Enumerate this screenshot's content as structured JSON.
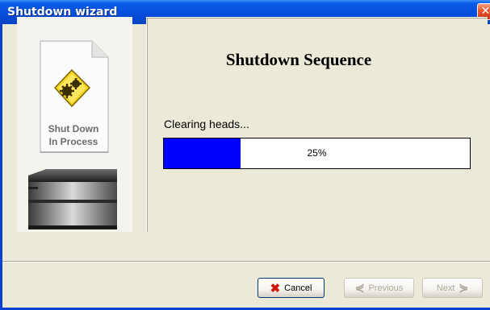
{
  "window": {
    "title": "Shutdown wizard",
    "close_icon": "close-icon"
  },
  "sidebar": {
    "status_caption_line1": "Shut Down",
    "status_caption_line2": "In Process",
    "gear_icon": "gears-icon",
    "device_icon": "printer-icon"
  },
  "main": {
    "heading": "Shutdown Sequence",
    "status_text": "Clearing heads...",
    "progress": {
      "value_percent": 25,
      "label": "25%",
      "fill_color": "#0000ff"
    }
  },
  "buttons": {
    "cancel_label": "Cancel",
    "previous_label": "Previous",
    "next_label": "Next",
    "previous_enabled": false,
    "next_enabled": false
  },
  "colors": {
    "titlebar": "#0a5ce8",
    "dialog_bg": "#ece9d8",
    "cancel_x": "#cc1a0c"
  }
}
